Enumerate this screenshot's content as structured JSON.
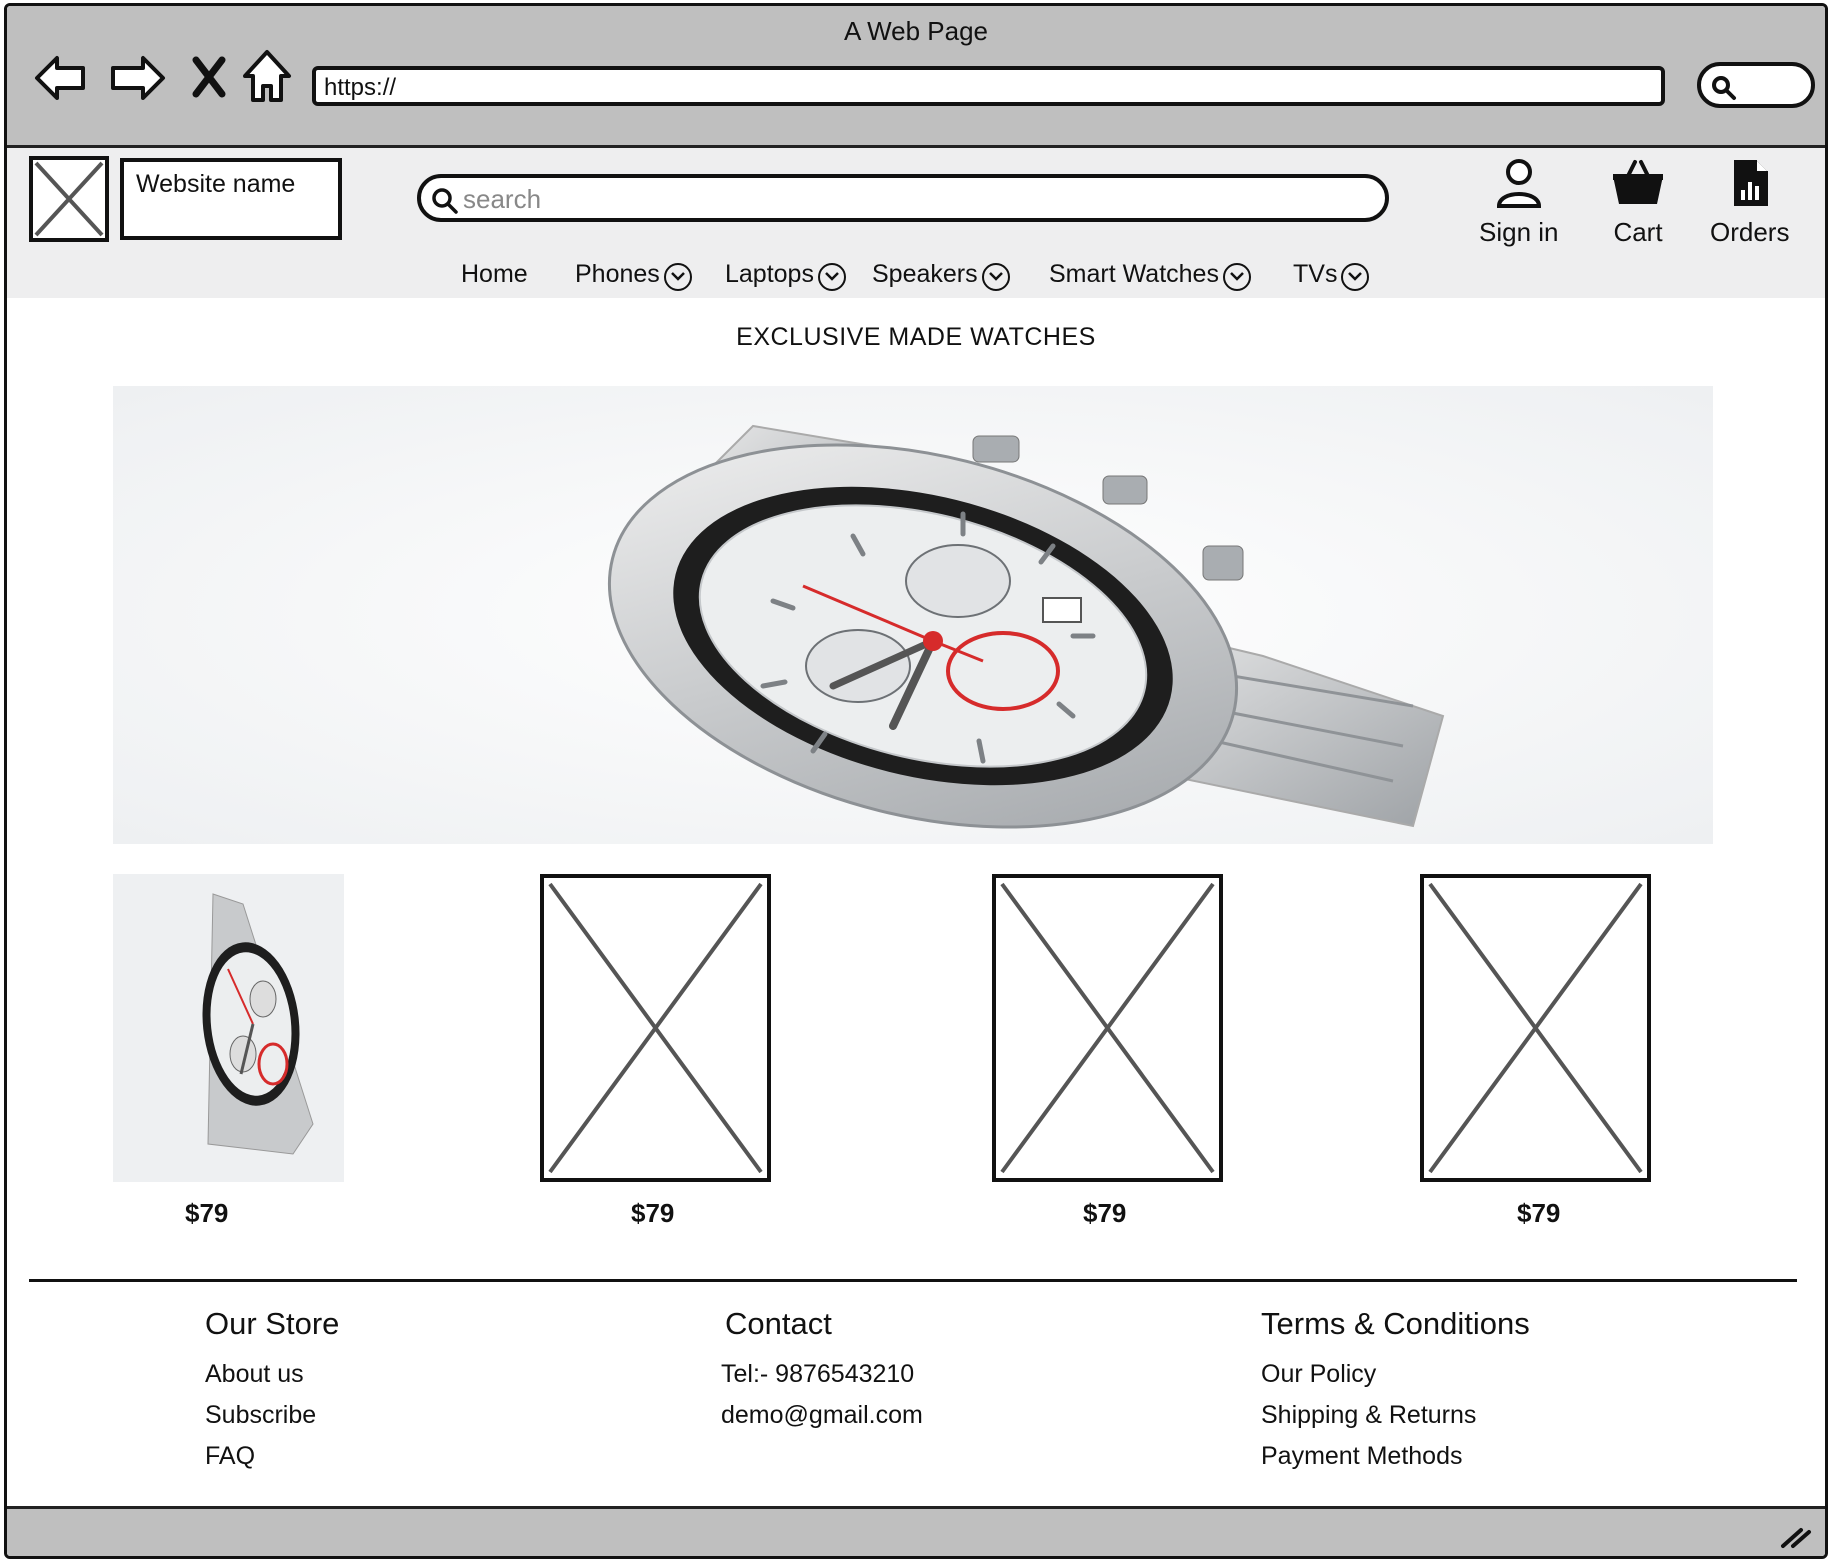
{
  "browser": {
    "window_title": "A Web Page",
    "url": "https://",
    "icons": [
      "back-icon",
      "forward-icon",
      "stop-icon",
      "home-icon",
      "search-icon"
    ]
  },
  "header": {
    "site_name": "Website name",
    "search_placeholder": "search",
    "actions": [
      {
        "label": "Sign in",
        "icon": "user-icon"
      },
      {
        "label": "Cart",
        "icon": "basket-icon"
      },
      {
        "label": "Orders",
        "icon": "orders-icon"
      }
    ]
  },
  "nav": {
    "items": [
      {
        "label": "Home"
      },
      {
        "label": "Phones",
        "dropdown": true
      },
      {
        "label": "Laptops",
        "dropdown": true
      },
      {
        "label": "Speakers",
        "dropdown": true
      },
      {
        "label": "Smart Watches",
        "dropdown": true
      },
      {
        "label": "TVs",
        "dropdown": true
      }
    ]
  },
  "main": {
    "headline": "EXCLUSIVE MADE WATCHES",
    "products": [
      {
        "price": "$79",
        "image": "watch"
      },
      {
        "price": "$79",
        "image": "placeholder"
      },
      {
        "price": "$79",
        "image": "placeholder"
      },
      {
        "price": "$79",
        "image": "placeholder"
      }
    ]
  },
  "footer": {
    "store": {
      "title": "Our Store",
      "links": [
        "About us",
        "Subscribe",
        "FAQ"
      ]
    },
    "contact": {
      "title": "Contact",
      "lines": [
        "Tel:- 9876543210",
        "demo@gmail.com"
      ]
    },
    "terms": {
      "title": "Terms & Conditions",
      "links": [
        "Our Policy",
        "Shipping & Returns",
        "Payment Methods"
      ]
    }
  },
  "colors": {
    "chrome": "#bfbfbf",
    "header_bg": "#eeeeef",
    "accent_red": "#d62b2b"
  }
}
